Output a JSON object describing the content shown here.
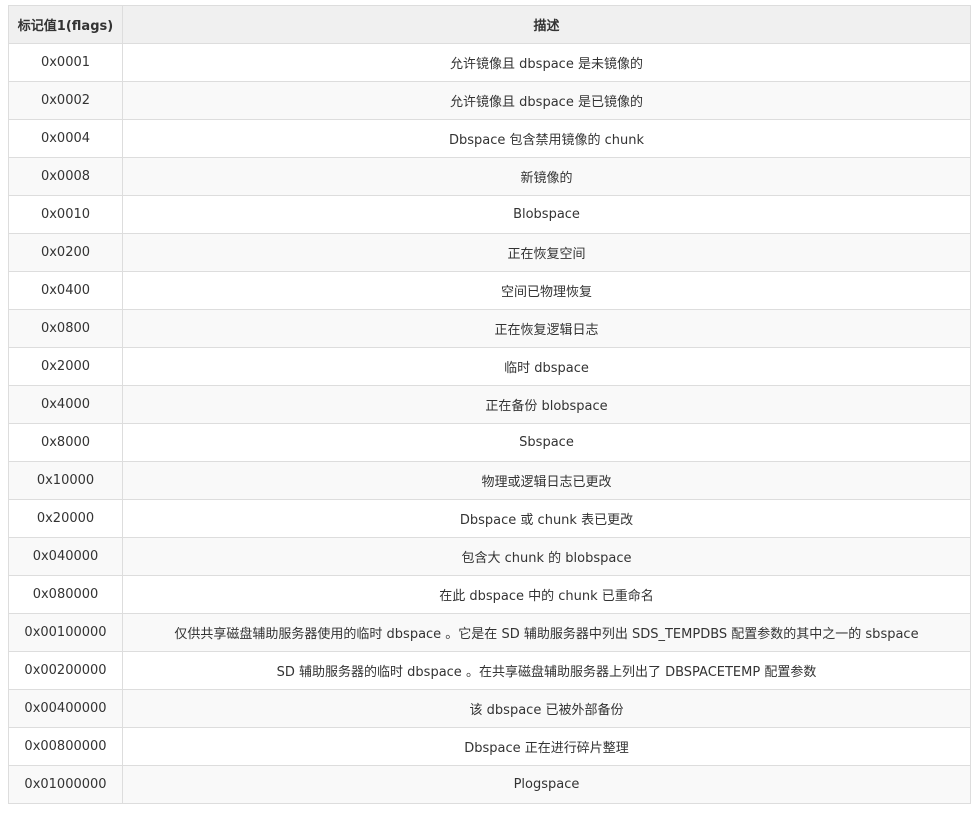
{
  "table": {
    "headers": {
      "flag": "标记值1(flags)",
      "description": "描述"
    },
    "rows": [
      {
        "flag": "0x0001",
        "description": "允许镜像且 dbspace 是未镜像的"
      },
      {
        "flag": "0x0002",
        "description": "允许镜像且 dbspace 是已镜像的"
      },
      {
        "flag": "0x0004",
        "description": "Dbspace 包含禁用镜像的 chunk"
      },
      {
        "flag": "0x0008",
        "description": "新镜像的"
      },
      {
        "flag": "0x0010",
        "description": "Blobspace"
      },
      {
        "flag": "0x0200",
        "description": "正在恢复空间"
      },
      {
        "flag": "0x0400",
        "description": "空间已物理恢复"
      },
      {
        "flag": "0x0800",
        "description": "正在恢复逻辑日志"
      },
      {
        "flag": "0x2000",
        "description": "临时 dbspace"
      },
      {
        "flag": "0x4000",
        "description": "正在备份 blobspace"
      },
      {
        "flag": "0x8000",
        "description": "Sbspace"
      },
      {
        "flag": "0x10000",
        "description": "物理或逻辑日志已更改"
      },
      {
        "flag": "0x20000",
        "description": "Dbspace 或 chunk 表已更改"
      },
      {
        "flag": "0x040000",
        "description": "包含大 chunk 的 blobspace"
      },
      {
        "flag": "0x080000",
        "description": "在此 dbspace 中的 chunk 已重命名"
      },
      {
        "flag": "0x00100000",
        "description": "仅供共享磁盘辅助服务器使用的临时 dbspace 。它是在 SD 辅助服务器中列出 SDS_TEMPDBS 配置参数的其中之一的 sbspace"
      },
      {
        "flag": "0x00200000",
        "description": "SD 辅助服务器的临时 dbspace 。在共享磁盘辅助服务器上列出了 DBSPACETEMP 配置参数"
      },
      {
        "flag": "0x00400000",
        "description": "该 dbspace 已被外部备份"
      },
      {
        "flag": "0x00800000",
        "description": "Dbspace 正在进行碎片整理"
      },
      {
        "flag": "0x01000000",
        "description": "Plogspace"
      }
    ]
  }
}
